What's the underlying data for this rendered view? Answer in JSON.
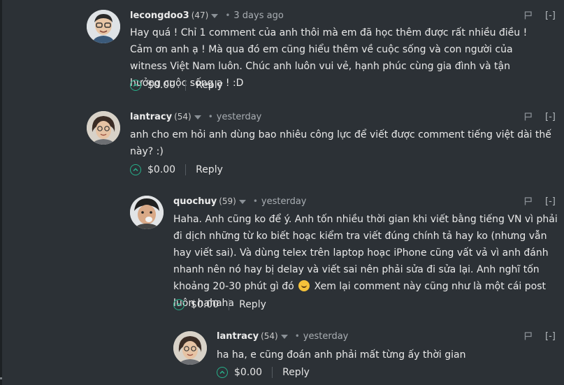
{
  "comments": [
    {
      "author": "lecongdoo3",
      "reputation": "(47)",
      "time": "3 days ago",
      "collapse": "[-]",
      "body": "Hay quá ! Chỉ 1 comment của anh thôi mà em đã học thêm được rất nhiều điều ! Cảm ơn anh ạ ! Mà qua đó em cũng hiểu thêm về cuộc sống và con người của witness Việt Nam luôn. Chúc anh luôn vui vẻ, hạnh phúc cùng gia đình và tận hưởng cuộc sống ạ ! :D",
      "payout": "$0.00",
      "reply": "Reply"
    },
    {
      "author": "lantracy",
      "reputation": "(54)",
      "time": "yesterday",
      "collapse": "[-]",
      "body": "anh cho em hỏi anh dùng bao nhiêu công lực để viết được comment tiếng việt dài thế này? :)",
      "payout": "$0.00",
      "reply": "Reply"
    },
    {
      "author": "quochuy",
      "reputation": "(59)",
      "time": "yesterday",
      "collapse": "[-]",
      "body_part1": "Haha. Anh cũng ko để ý. Anh tốn nhiều thời gian khi viết bằng tiếng VN vì phải đi dịch những từ ko biết hoạc kiểm tra viết đúng chính tả hay ko (nhưng vẫn hay viết sai). Và dùng telex trên laptop hoạc iPhone cũng vất vả vì anh đánh nhanh nên nó hay bị delay và viết sai nên phải sửa đi sửa lại. Anh nghĩ tốn khoảng 20-30 phút gì đó",
      "body_part2": "Xem lại comment này cũng như là một cái post luôn hahaha",
      "payout": "$0.00",
      "reply": "Reply"
    },
    {
      "author": "lantracy",
      "reputation": "(54)",
      "time": "yesterday",
      "collapse": "[-]",
      "body": "ha ha, e cũng đoán anh phải mất từng ấy thời gian",
      "payout": "$0.00",
      "reply": "Reply"
    }
  ],
  "icons": {
    "flag": "flag-icon",
    "upvote": "chevron-up-icon",
    "emoji": "rolling-laughing-emoji-icon"
  },
  "colors": {
    "background": "#2c3136",
    "upvote": "#27b08a"
  }
}
